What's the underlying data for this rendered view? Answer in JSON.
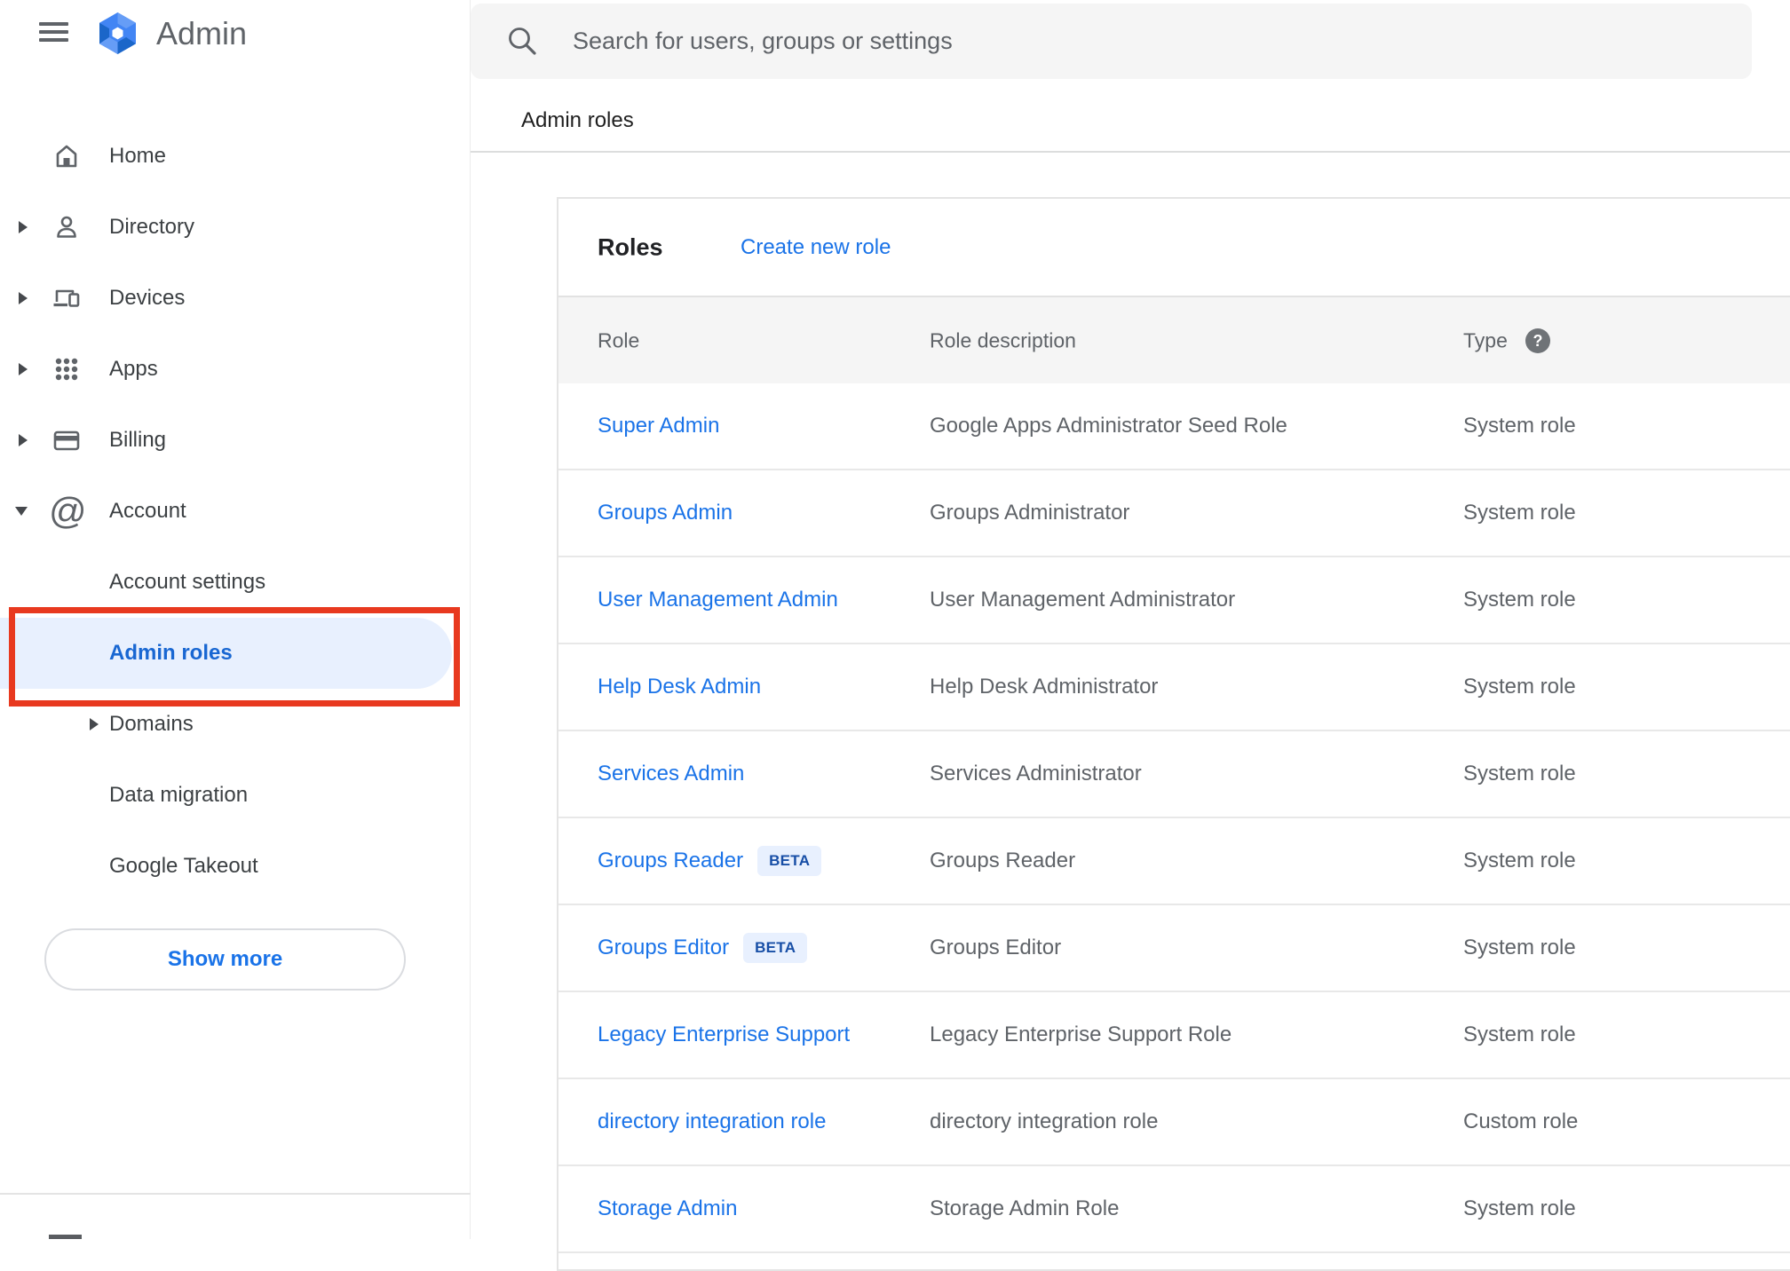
{
  "brand": {
    "title": "Admin"
  },
  "search": {
    "placeholder": "Search for users, groups or settings"
  },
  "breadcrumb": {
    "label": "Admin roles"
  },
  "sidebar": {
    "items": [
      {
        "label": "Home",
        "expandable": false
      },
      {
        "label": "Directory",
        "expandable": true
      },
      {
        "label": "Devices",
        "expandable": true
      },
      {
        "label": "Apps",
        "expandable": true
      },
      {
        "label": "Billing",
        "expandable": true
      },
      {
        "label": "Account",
        "expandable": true,
        "expanded": true
      }
    ],
    "account_children": [
      {
        "label": "Account settings"
      },
      {
        "label": "Admin roles",
        "selected": true,
        "annotated": true
      },
      {
        "label": "Domains",
        "expandable": true
      },
      {
        "label": "Data migration"
      },
      {
        "label": "Google Takeout"
      }
    ],
    "show_more": {
      "label": "Show more"
    }
  },
  "roles_card": {
    "title": "Roles",
    "create_link": "Create new role",
    "columns": [
      {
        "label": "Role"
      },
      {
        "label": "Role description"
      },
      {
        "label": "Type",
        "help_icon": "question-mark"
      }
    ],
    "help_glyph": "?",
    "rows": [
      {
        "role": "Super Admin",
        "description": "Google Apps Administrator Seed Role",
        "type": "System role"
      },
      {
        "role": "Groups Admin",
        "description": "Groups Administrator",
        "type": "System role"
      },
      {
        "role": "User Management Admin",
        "description": "User Management Administrator",
        "type": "System role"
      },
      {
        "role": "Help Desk Admin",
        "description": "Help Desk Administrator",
        "type": "System role"
      },
      {
        "role": "Services Admin",
        "description": "Services Administrator",
        "type": "System role"
      },
      {
        "role": "Groups Reader",
        "badge": "BETA",
        "description": "Groups Reader",
        "type": "System role"
      },
      {
        "role": "Groups Editor",
        "badge": "BETA",
        "description": "Groups Editor",
        "type": "System role"
      },
      {
        "role": "Legacy Enterprise Support",
        "description": "Legacy Enterprise Support Role",
        "type": "System role"
      },
      {
        "role": "directory integration role",
        "description": "directory integration role",
        "type": "Custom role"
      },
      {
        "role": "Storage Admin",
        "description": "Storage Admin Role",
        "type": "System role"
      }
    ]
  },
  "colors": {
    "link_blue": "#1a73e8",
    "selected_blue": "#1967d2",
    "selected_bg": "#e8f0fe",
    "annotation_red": "#e8391f",
    "beta_bg": "#e8f0fe",
    "beta_text": "#174ea6",
    "header_row_bg": "#f5f5f5",
    "search_bg": "#f5f5f5",
    "gray_text": "#5f6368"
  }
}
